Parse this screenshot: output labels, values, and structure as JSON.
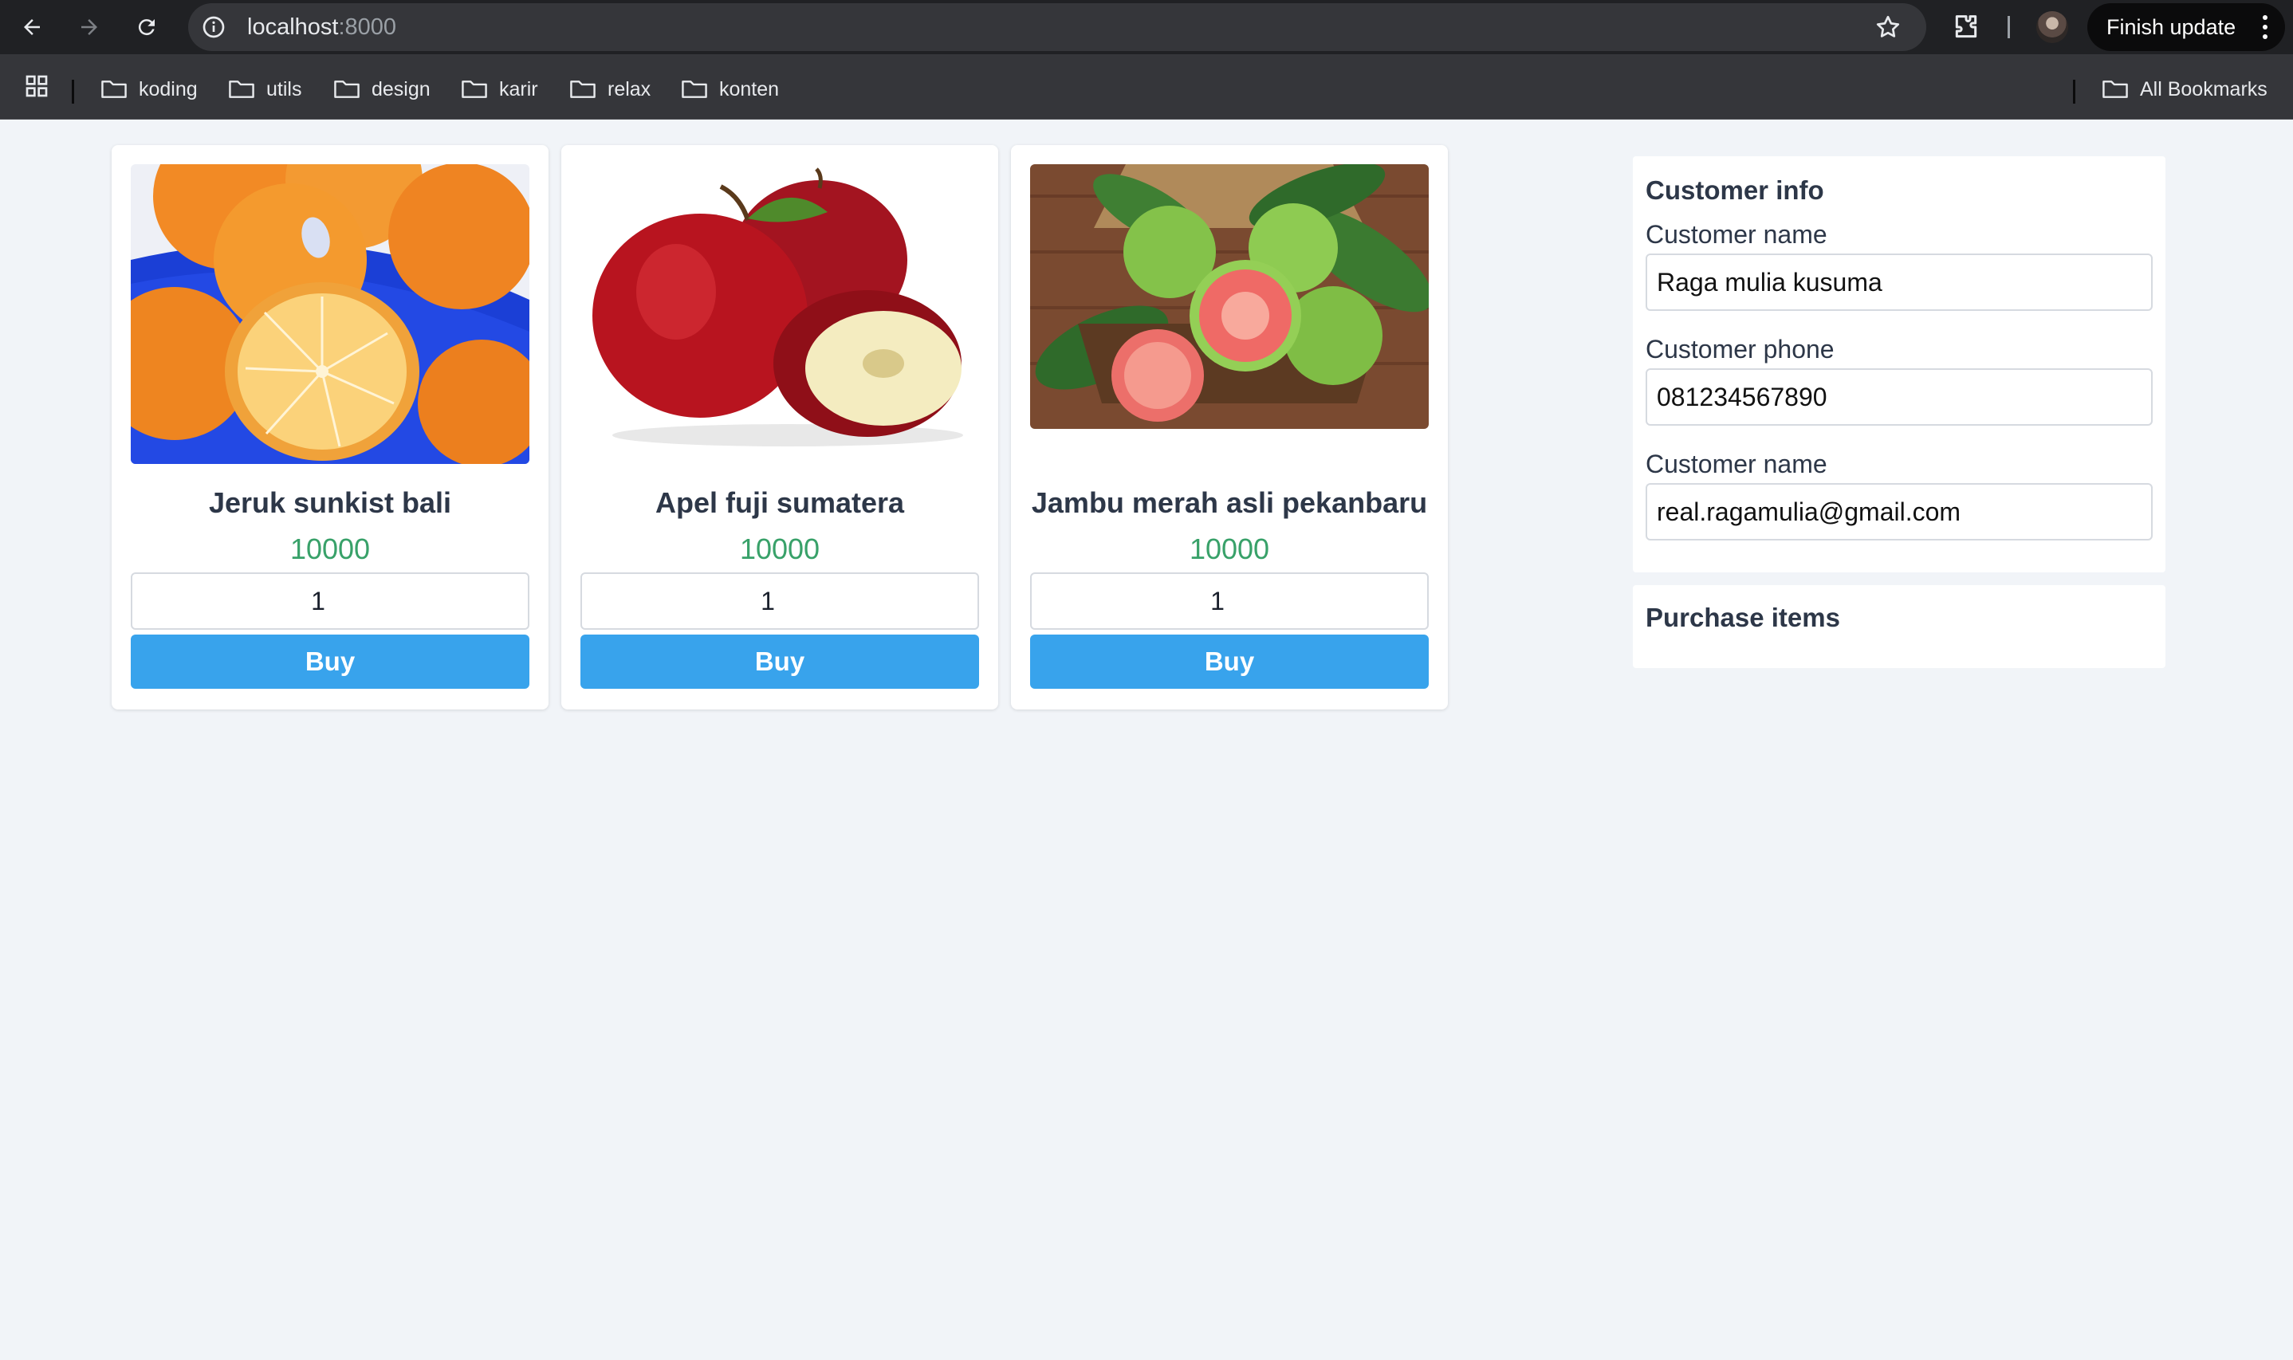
{
  "browser": {
    "url_host": "localhost",
    "url_port": ":8000",
    "finish_update_label": "Finish update",
    "bookmarks": [
      "koding",
      "utils",
      "design",
      "karir",
      "relax",
      "konten"
    ],
    "all_bookmarks_label": "All Bookmarks"
  },
  "products": [
    {
      "name": "Jeruk sunkist bali",
      "price": "10000",
      "qty": "1",
      "buy_label": "Buy",
      "image": "oranges"
    },
    {
      "name": "Apel fuji sumatera",
      "price": "10000",
      "qty": "1",
      "buy_label": "Buy",
      "image": "apples"
    },
    {
      "name": "Jambu merah asli pekanbaru",
      "price": "10000",
      "qty": "1",
      "buy_label": "Buy",
      "image": "guavas"
    }
  ],
  "customer_info": {
    "heading": "Customer info",
    "name_label": "Customer name",
    "name_value": "Raga mulia kusuma",
    "phone_label": "Customer phone",
    "phone_value": "081234567890",
    "email_label": "Customer name",
    "email_value": "real.ragamulia@gmail.com"
  },
  "purchase_items": {
    "heading": "Purchase items"
  },
  "colors": {
    "price_green": "#38a169",
    "buy_blue": "#38a3ec",
    "page_bg": "#f1f4f8"
  }
}
